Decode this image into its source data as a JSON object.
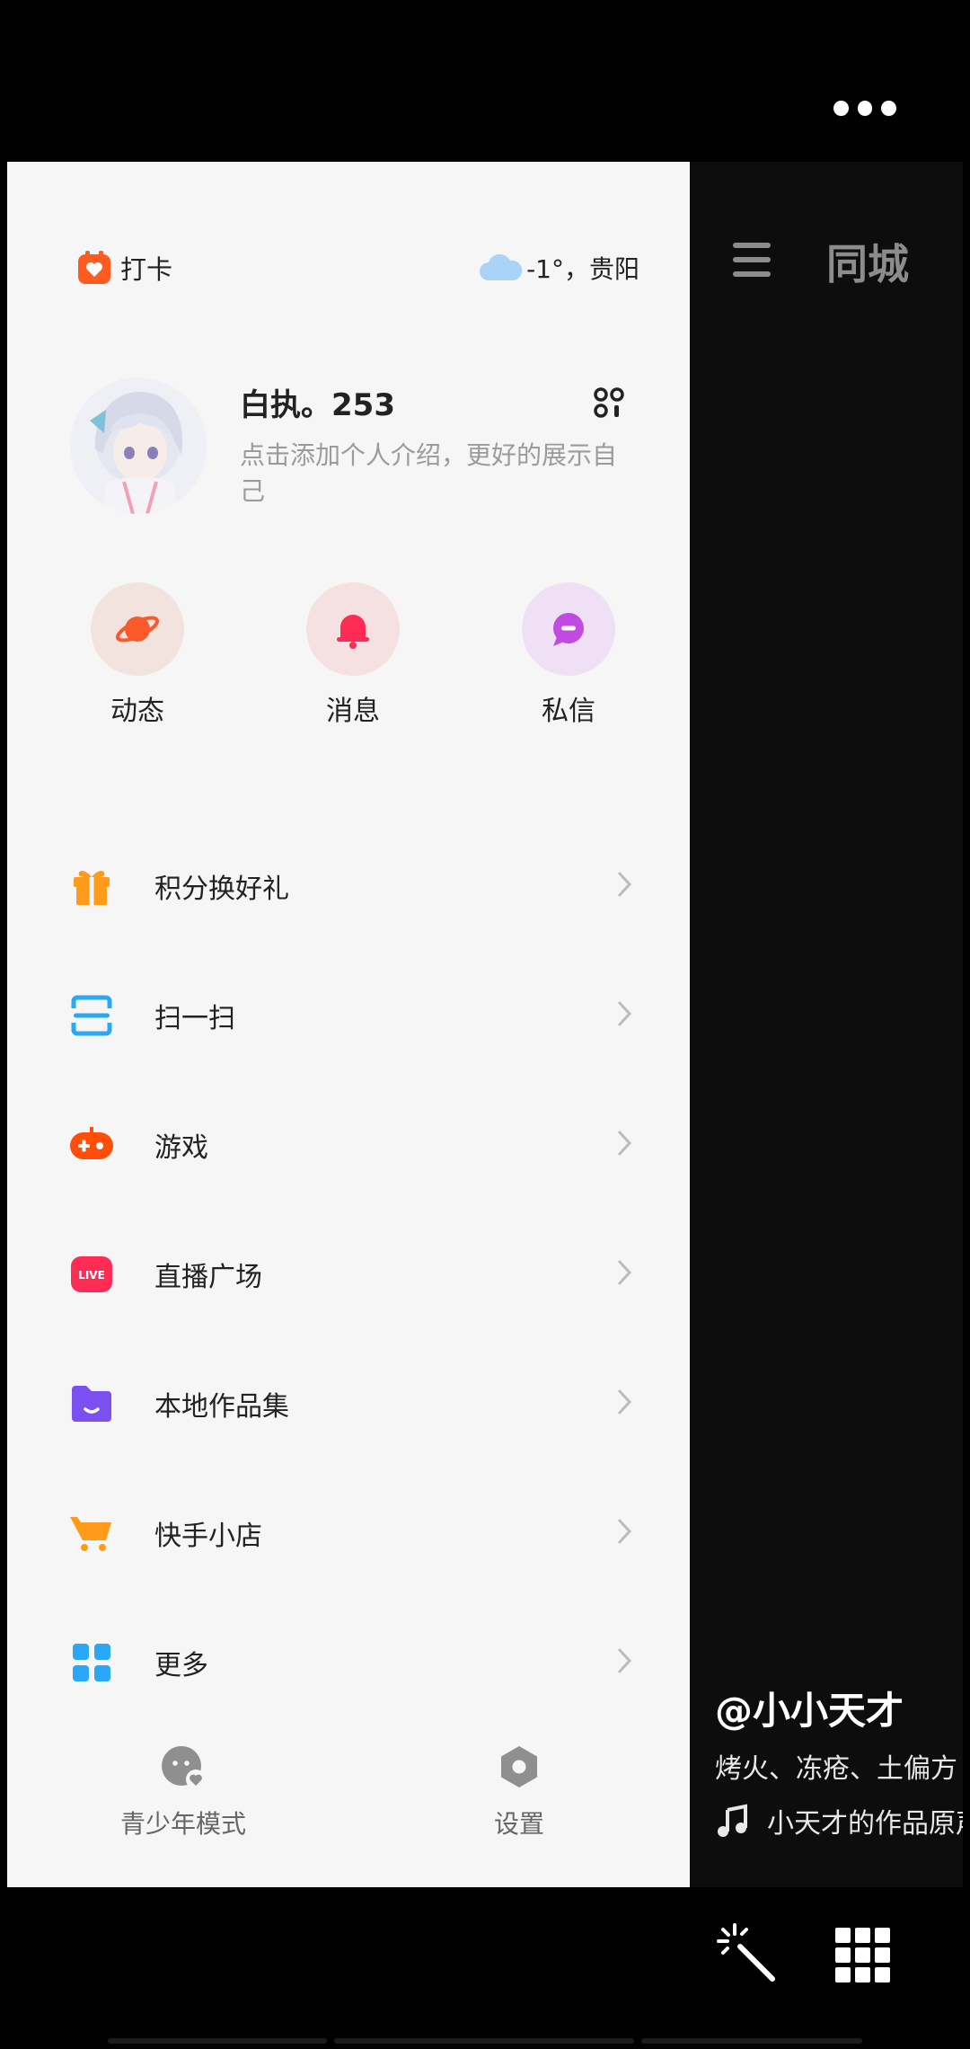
{
  "drawer": {
    "checkin_label": "打卡",
    "weather_text": "-1°，贵阳",
    "profile": {
      "username": "白执。253",
      "bio": "点击添加个人介绍，更好的展示自己"
    },
    "shortcuts": [
      {
        "label": "动态",
        "icon": "planet-icon",
        "bg": "#f3e3df",
        "color": "#fa5a2a"
      },
      {
        "label": "消息",
        "icon": "bell-icon",
        "bg": "#f5e0e2",
        "color": "#fe2c55"
      },
      {
        "label": "私信",
        "icon": "chat-bubble-icon",
        "bg": "#f0e0f5",
        "color": "#c04be3"
      }
    ],
    "menu_items": [
      {
        "label": "积分换好礼",
        "icon": "gift-icon",
        "color": "#ff9a1a"
      },
      {
        "label": "扫一扫",
        "icon": "scan-icon",
        "color": "#2aa8f5"
      },
      {
        "label": "游戏",
        "icon": "gamepad-icon",
        "color": "#ff4d0a"
      },
      {
        "label": "直播广场",
        "icon": "live-icon",
        "color": "#fe2c55"
      },
      {
        "label": "本地作品集",
        "icon": "folder-icon",
        "color": "#7c4ff0"
      },
      {
        "label": "快手小店",
        "icon": "cart-icon",
        "color": "#ff9a1a"
      },
      {
        "label": "更多",
        "icon": "grid-apps-icon",
        "color": "#2aa8f5"
      }
    ],
    "bottom_tools": {
      "teen_mode_label": "青少年模式",
      "settings_label": "设置"
    }
  },
  "feed": {
    "header_title": "同城",
    "author": "@小小天才",
    "caption": "烤火、冻疮、土偏方",
    "music": "小天才的作品原声"
  },
  "colors": {
    "brand_orange": "#ff5a1f",
    "drawer_bg": "#f6f6f6",
    "feed_bg": "#0d0d0d"
  }
}
